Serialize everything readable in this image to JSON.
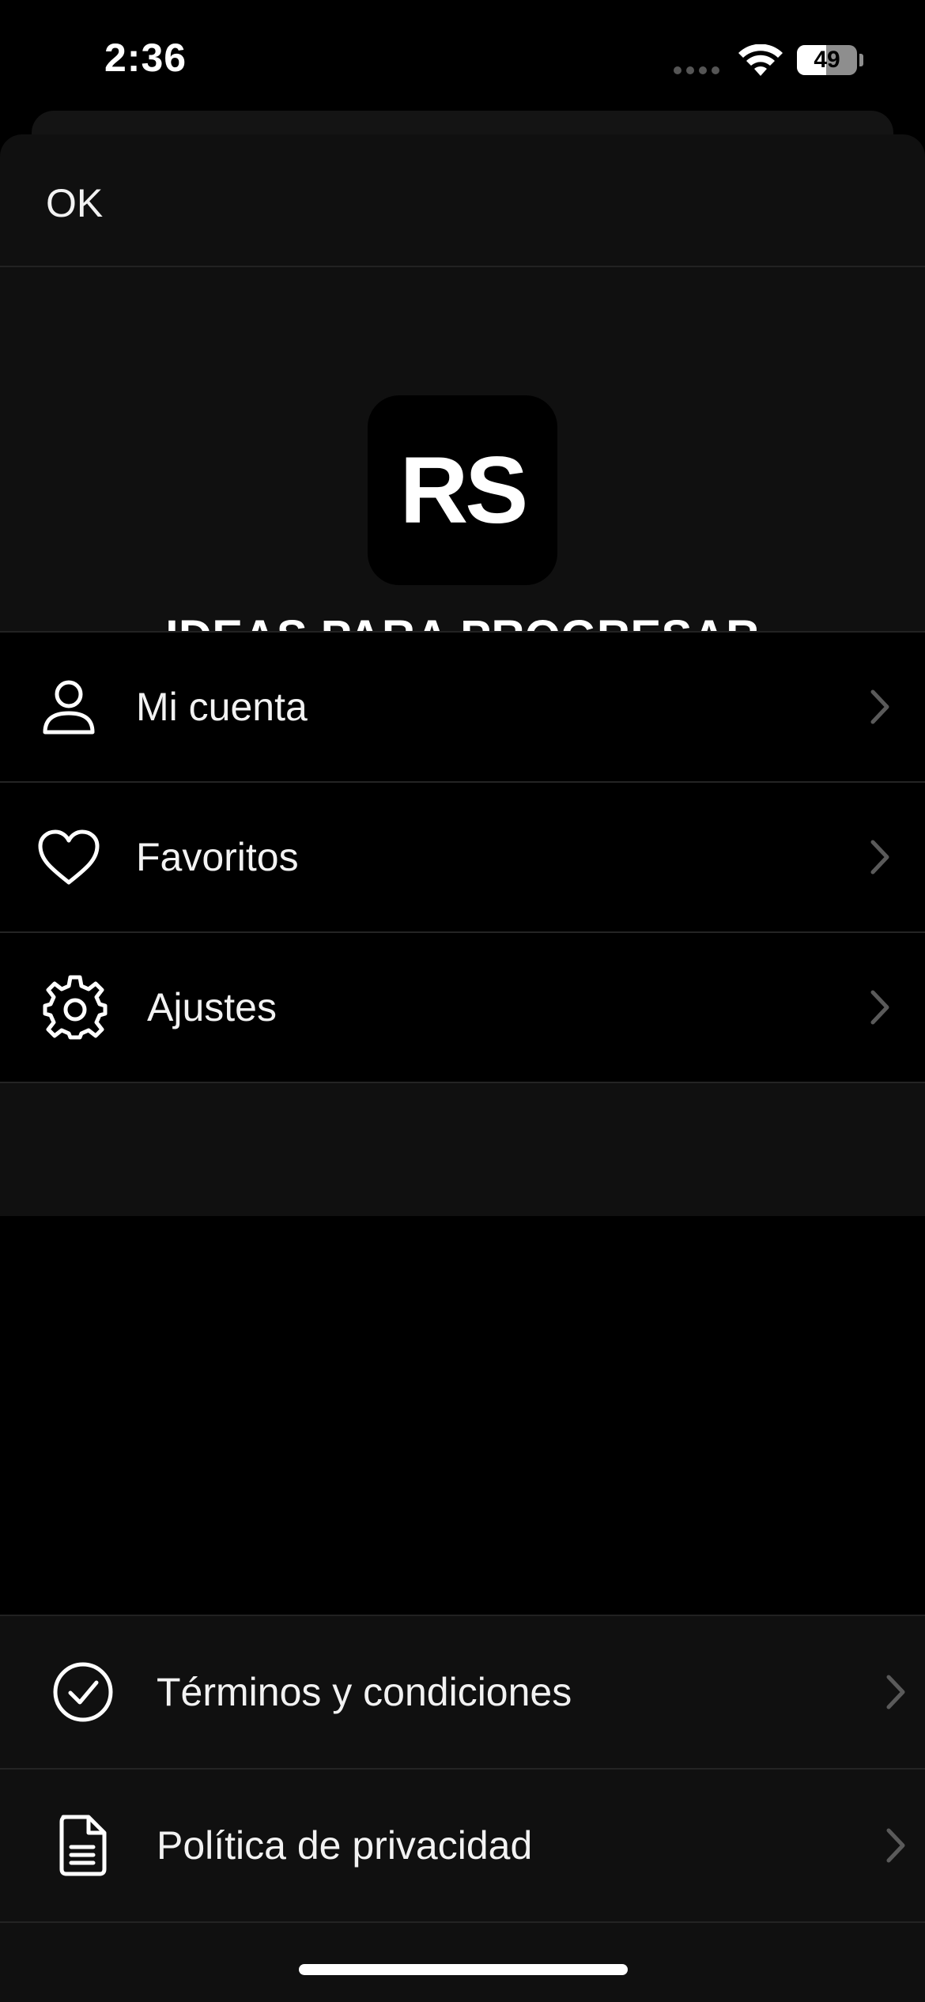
{
  "status_bar": {
    "time": "2:36",
    "battery_level": "49",
    "battery_fraction": 0.49
  },
  "sheet": {
    "ok_label": "OK",
    "logo_text": "RS",
    "app_title": "IDEAS PARA PROGRESAR"
  },
  "menu": {
    "items": [
      {
        "label": "Mi cuenta",
        "icon": "user-icon"
      },
      {
        "label": "Favoritos",
        "icon": "heart-icon"
      },
      {
        "label": "Ajustes",
        "icon": "gear-icon"
      }
    ]
  },
  "footer": {
    "items": [
      {
        "label": "Términos y condiciones",
        "icon": "check-circle-icon"
      },
      {
        "label": "Política de privacidad",
        "icon": "document-icon"
      }
    ]
  },
  "colors": {
    "background": "#000000",
    "sheet": "#101010",
    "text": "#f2f2f2",
    "divider": "#242424",
    "chevron": "#5a5a5a"
  }
}
